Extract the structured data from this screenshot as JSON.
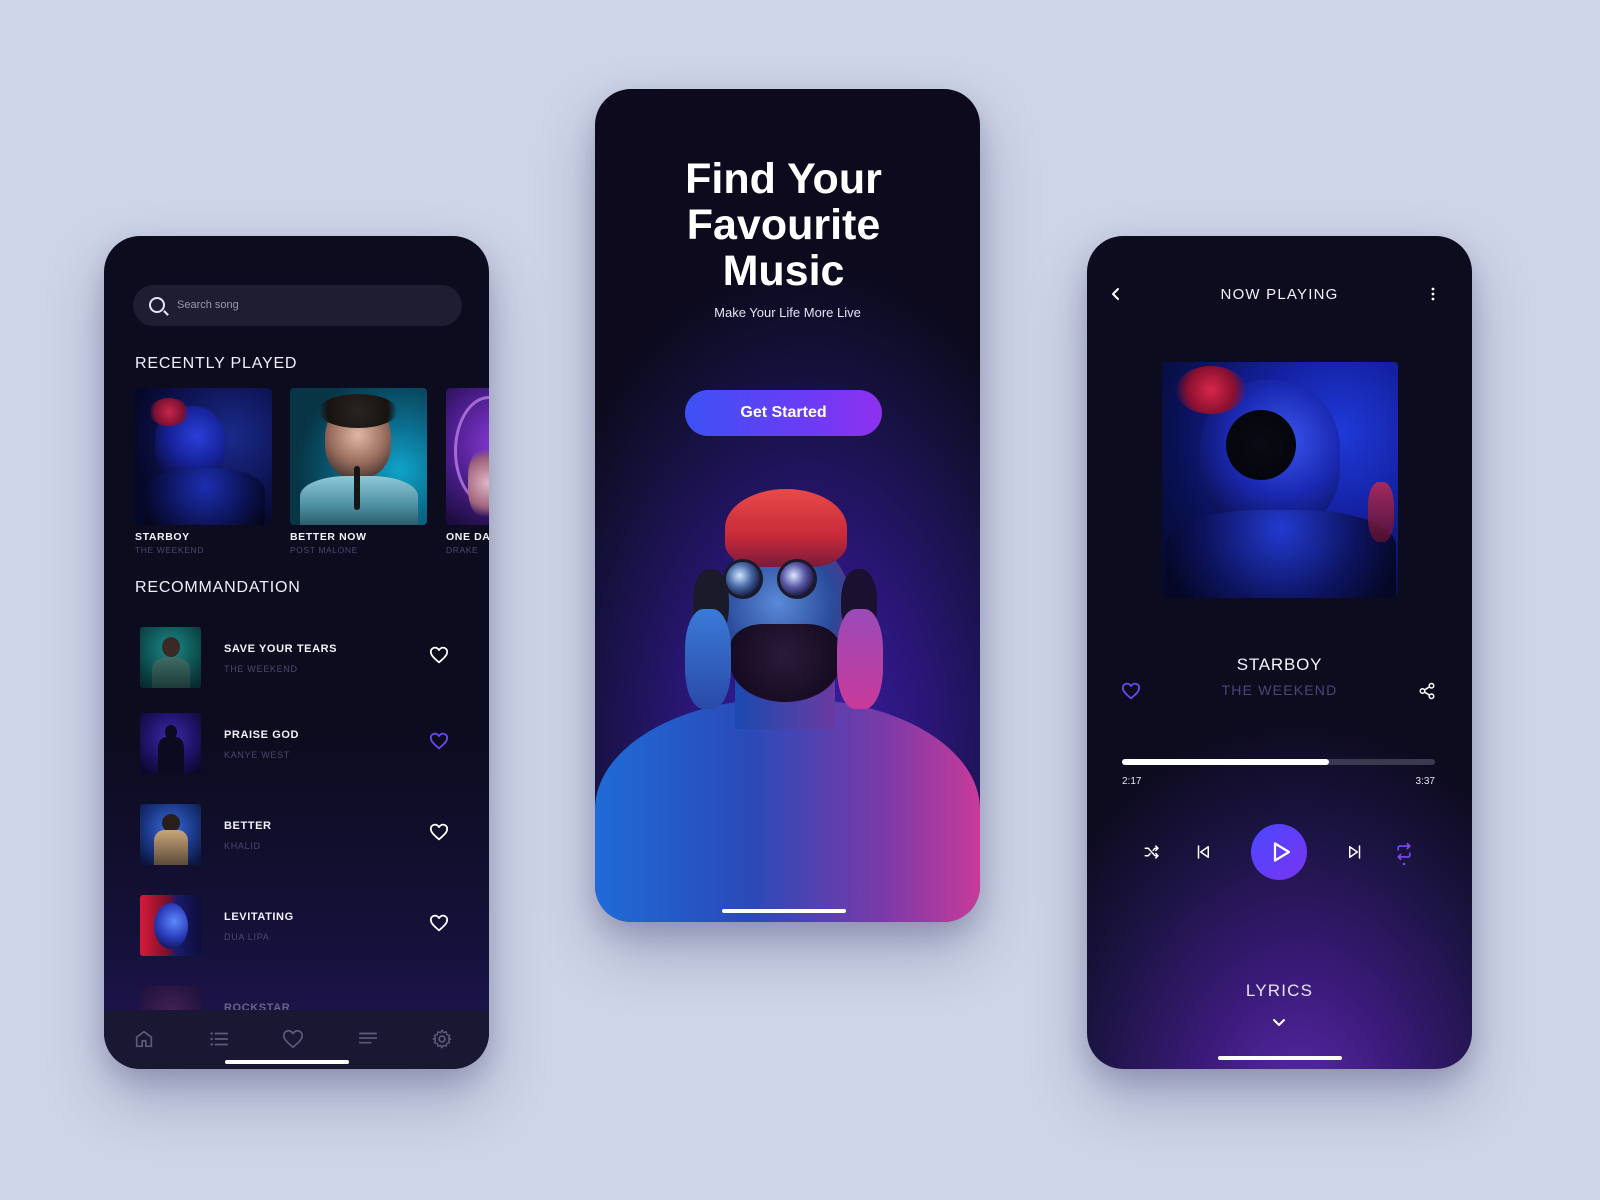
{
  "colors": {
    "accent": "#6a3cf5",
    "background": "#cfd5e8",
    "panel": "#0d0b1e"
  },
  "library": {
    "search_placeholder": "Search song",
    "recently_played_title": "RECENTLY PLAYED",
    "recently_played": [
      {
        "name": "STARBOY",
        "artist": "THE WEEKEND"
      },
      {
        "name": "BETTER NOW",
        "artist": "POST MALONE"
      },
      {
        "name": "ONE DA",
        "artist": "DRAKE"
      }
    ],
    "recommendation_title": "RECOMMANDATION",
    "recommendations": [
      {
        "name": "SAVE YOUR TEARS",
        "artist": "THE WEEKEND",
        "liked": false
      },
      {
        "name": "PRAISE GOD",
        "artist": "KANYE WEST",
        "liked": true
      },
      {
        "name": "BETTER",
        "artist": "KHALID",
        "liked": false
      },
      {
        "name": "LEVITATING",
        "artist": "DUA LIPA",
        "liked": false
      },
      {
        "name": "ROCKSTAR",
        "artist": "",
        "liked": false
      }
    ],
    "tabs": [
      "home-icon",
      "list-icon",
      "heart-icon",
      "queue-icon",
      "settings-icon"
    ]
  },
  "onboarding": {
    "title_line1": "Find Your",
    "title_line2": "Favourite",
    "title_line3": "Music",
    "subtitle": "Make Your Life More Live",
    "cta_label": "Get Started"
  },
  "player": {
    "header_title": "NOW PLAYING",
    "song_title": "STARBOY",
    "song_artist": "THE WEEKEND",
    "elapsed": "2:17",
    "duration": "3:37",
    "progress": 0.66,
    "lyrics_label": "LYRICS"
  }
}
